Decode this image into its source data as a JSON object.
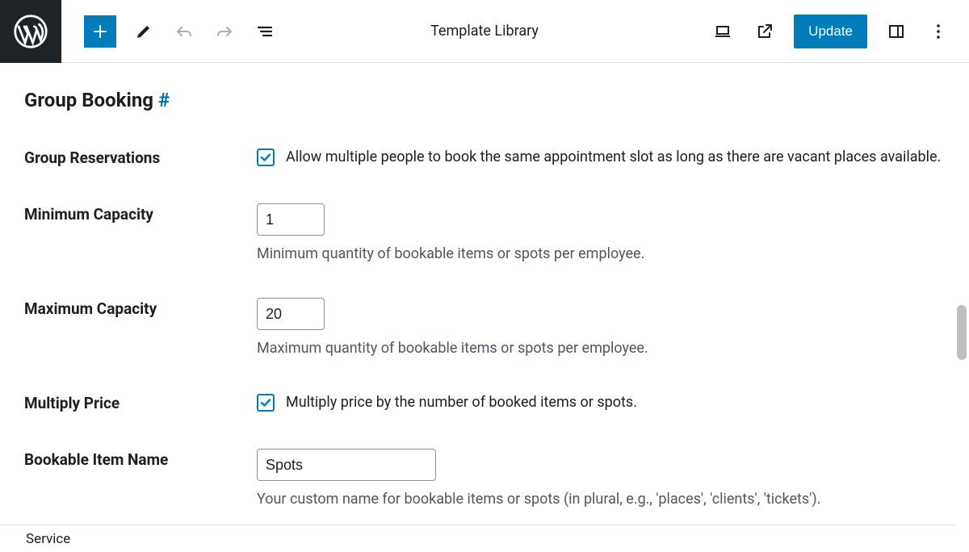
{
  "toolbar": {
    "center_label": "Template Library",
    "update_label": "Update"
  },
  "section": {
    "title": "Group Booking",
    "anchor": "#"
  },
  "fields": {
    "group_reservations": {
      "label": "Group Reservations",
      "text": "Allow multiple people to book the same appointment slot as long as there are vacant places available.",
      "checked": true
    },
    "min_capacity": {
      "label": "Minimum Capacity",
      "value": "1",
      "help": "Minimum quantity of bookable items or spots per employee."
    },
    "max_capacity": {
      "label": "Maximum Capacity",
      "value": "20",
      "help": "Maximum quantity of bookable items or spots per employee."
    },
    "multiply_price": {
      "label": "Multiply Price",
      "text": "Multiply price by the number of booked items or spots.",
      "checked": true
    },
    "item_name": {
      "label": "Bookable Item Name",
      "value": "Spots",
      "help": "Your custom name for bookable items or spots (in plural, e.g., 'places', 'clients', 'tickets')."
    }
  },
  "status": {
    "breadcrumb": "Service"
  }
}
